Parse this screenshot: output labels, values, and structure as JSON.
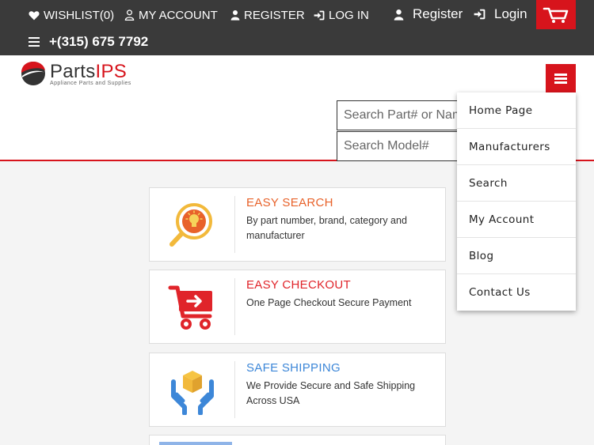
{
  "topbar": {
    "wishlist_label": "WISHLIST(0)",
    "my_account_label": "MY ACCOUNT",
    "register_label": "REGISTER",
    "login_label": "LOG IN",
    "register2_label": "Register",
    "login2_label": "Login",
    "phone": "+(315) 675 7792"
  },
  "logo": {
    "name_part1": "Parts",
    "name_part2": "IPS",
    "tagline": "Appliance Parts and Supplies"
  },
  "search": {
    "part_placeholder": "Search Part# or Name",
    "model_placeholder": "Search Model#"
  },
  "menu": {
    "items": [
      {
        "label": "Home Page"
      },
      {
        "label": "Manufacturers"
      },
      {
        "label": "Search"
      },
      {
        "label": "My Account"
      },
      {
        "label": "Blog"
      },
      {
        "label": "Contact Us"
      }
    ]
  },
  "features": [
    {
      "title": "EASY SEARCH",
      "desc": "By part number, brand, category and manufacturer",
      "color": "#e8622a",
      "icon": "magnifier-lightbulb-icon"
    },
    {
      "title": "EASY CHECKOUT",
      "desc": "One Page Checkout Secure Payment",
      "color": "#e0242a",
      "icon": "cart-arrow-icon"
    },
    {
      "title": "SAFE SHIPPING",
      "desc": "We Provide Secure and Safe Shipping Across USA",
      "color": "#3d87d8",
      "icon": "hands-box-icon"
    }
  ],
  "colors": {
    "brand_red": "#d7141c",
    "topbar_bg": "#3a3a3a"
  }
}
